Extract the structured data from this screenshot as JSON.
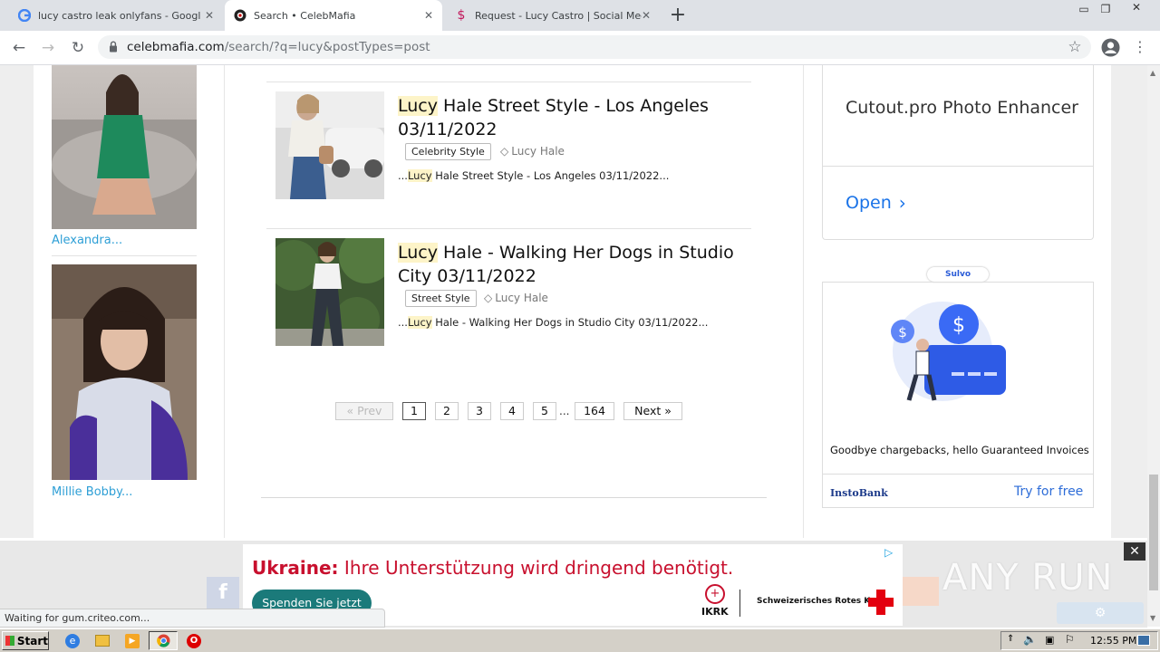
{
  "browser": {
    "tabs": [
      {
        "title": "lucy castro leak onlyfans - Google Se",
        "active": false
      },
      {
        "title": "Search • CelebMafia",
        "active": true
      },
      {
        "title": "Request - Lucy Castro | Social Media",
        "active": false
      }
    ],
    "url_domain": "celebmafia.com",
    "url_path": "/search/?q=lucy&postTypes=post"
  },
  "sidebar": {
    "items": [
      {
        "caption": "Alexandra..."
      },
      {
        "caption": "Millie Bobby..."
      }
    ]
  },
  "posts": [
    {
      "title_hl": "Lucy",
      "title_rest": " Hale Street Style - Los Angeles 03/11/2022",
      "category": "Celebrity Style",
      "person_tag": "Lucy Hale",
      "excerpt_pre": "...",
      "excerpt_hl": "Lucy",
      "excerpt_rest": " Hale Street Style - Los Angeles 03/11/2022..."
    },
    {
      "title_hl": "Lucy",
      "title_rest": " Hale - Walking Her Dogs in Studio City 03/11/2022",
      "category": "Street Style",
      "person_tag": "Lucy Hale",
      "excerpt_pre": "...",
      "excerpt_hl": "Lucy",
      "excerpt_rest": " Hale - Walking Her Dogs in Studio City 03/11/2022..."
    }
  ],
  "pagination": {
    "prev": "« Prev",
    "pages": [
      "1",
      "2",
      "3",
      "4",
      "5"
    ],
    "ellipsis": "...",
    "last": "164",
    "next": "Next »",
    "current": "1"
  },
  "right_ads": {
    "ad1_title": "Cutout.pro Photo Enhancer",
    "ad1_open": "Open",
    "ad2_brand_top": "Sulvo",
    "ad2_tagline": "Goodbye chargebacks, hello Guaranteed Invoices",
    "ad2_logo": "InstoBank",
    "ad2_cta": "Try for free"
  },
  "bottom_ad": {
    "headline_bold": "Ukraine:",
    "headline_rest": " Ihre Unterstützung wird dringend benötigt.",
    "cta": "Spenden Sie jetzt",
    "org1": "IKRK",
    "org2": "Schweizerisches Rotes Kreuz"
  },
  "watermark": "ANY RUN",
  "status_bar": "Waiting for gum.criteo.com...",
  "taskbar": {
    "start": "Start",
    "time": "12:55 PM"
  },
  "colors": {
    "link": "#2e9fd6",
    "highlight": "#fdf4c8",
    "ad_accent": "#c8102e",
    "cta_bg": "#1b7a7a"
  }
}
